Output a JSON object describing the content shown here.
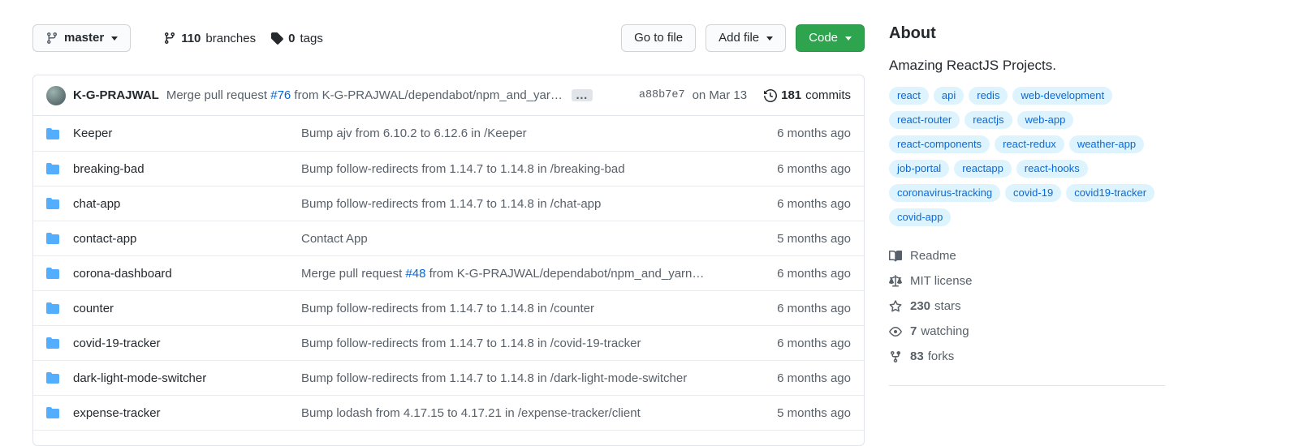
{
  "toolbar": {
    "branch": "master",
    "branches_count": "110",
    "branches_label": "branches",
    "tags_count": "0",
    "tags_label": "tags",
    "go_to_file": "Go to file",
    "add_file": "Add file",
    "code": "Code"
  },
  "commit": {
    "author": "K-G-PRAJWAL",
    "msg_pre": "Merge pull request ",
    "pr_link": "#76",
    "msg_post": " from K-G-PRAJWAL/dependabot/npm_and_yar…",
    "expander": "…",
    "hash": "a88b7e7",
    "date": "on Mar 13",
    "commits_count": "181",
    "commits_label": "commits"
  },
  "files": [
    {
      "name": "Keeper",
      "msg_pre": "Bump ajv from 6.10.2 to 6.12.6 in /Keeper",
      "msg_link": "",
      "msg_post": "",
      "age": "6 months ago"
    },
    {
      "name": "breaking-bad",
      "msg_pre": "Bump follow-redirects from 1.14.7 to 1.14.8 in /breaking-bad",
      "msg_link": "",
      "msg_post": "",
      "age": "6 months ago"
    },
    {
      "name": "chat-app",
      "msg_pre": "Bump follow-redirects from 1.14.7 to 1.14.8 in /chat-app",
      "msg_link": "",
      "msg_post": "",
      "age": "6 months ago"
    },
    {
      "name": "contact-app",
      "msg_pre": "Contact App",
      "msg_link": "",
      "msg_post": "",
      "age": "5 months ago"
    },
    {
      "name": "corona-dashboard",
      "msg_pre": "Merge pull request ",
      "msg_link": "#48",
      "msg_post": " from K-G-PRAJWAL/dependabot/npm_and_yarn…",
      "age": "6 months ago"
    },
    {
      "name": "counter",
      "msg_pre": "Bump follow-redirects from 1.14.7 to 1.14.8 in /counter",
      "msg_link": "",
      "msg_post": "",
      "age": "6 months ago"
    },
    {
      "name": "covid-19-tracker",
      "msg_pre": "Bump follow-redirects from 1.14.7 to 1.14.8 in /covid-19-tracker",
      "msg_link": "",
      "msg_post": "",
      "age": "6 months ago"
    },
    {
      "name": "dark-light-mode-switcher",
      "msg_pre": "Bump follow-redirects from 1.14.7 to 1.14.8 in /dark-light-mode-switcher",
      "msg_link": "",
      "msg_post": "",
      "age": "6 months ago"
    },
    {
      "name": "expense-tracker",
      "msg_pre": "Bump lodash from 4.17.15 to 4.17.21 in /expense-tracker/client",
      "msg_link": "",
      "msg_post": "",
      "age": "5 months ago"
    }
  ],
  "sidebar": {
    "title": "About",
    "description": "Amazing ReactJS Projects.",
    "topics": [
      "react",
      "api",
      "redis",
      "web-development",
      "react-router",
      "reactjs",
      "web-app",
      "react-components",
      "react-redux",
      "weather-app",
      "job-portal",
      "reactapp",
      "react-hooks",
      "coronavirus-tracking",
      "covid-19",
      "covid19-tracker",
      "covid-app"
    ],
    "readme": "Readme",
    "license": "MIT license",
    "stars_count": "230",
    "stars_label": "stars",
    "watching_count": "7",
    "watching_label": "watching",
    "forks_count": "83",
    "forks_label": "forks"
  },
  "colors": {
    "code_button_green": "#2ea44f",
    "link_blue": "#0366d6",
    "topic_bg": "#ddf4ff",
    "topic_text": "#0969da",
    "folder_blue": "#54aeff"
  }
}
